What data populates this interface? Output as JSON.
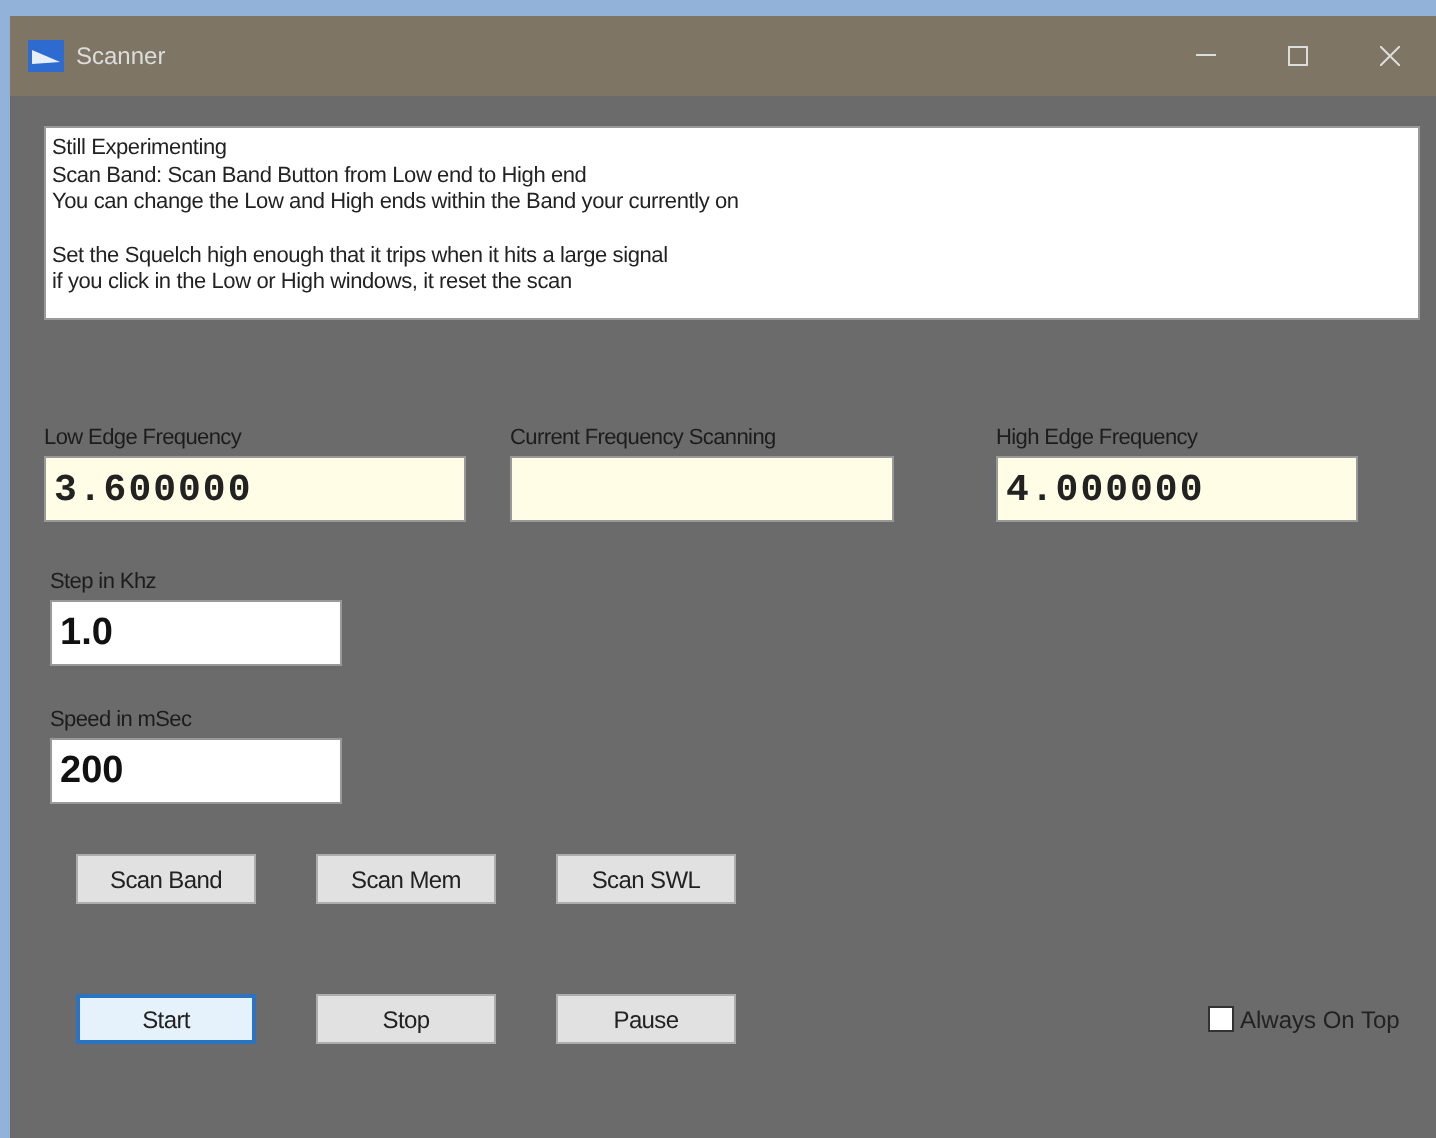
{
  "window": {
    "title": "Scanner"
  },
  "info": {
    "paragraphs": [
      {
        "lines": [
          "Still Experimenting",
          "Scan Band: Scan Band Button from Low end to High end",
          "You can change the Low and High ends within the Band your currently on"
        ]
      },
      {
        "lines": [
          "Set the Squelch high enough that it trips when it hits a large signal",
          "if you click in the Low or High windows, it reset the scan"
        ]
      }
    ]
  },
  "frequency_fields": [
    {
      "label": "Low Edge Frequency",
      "value": "3.600000"
    },
    {
      "label": "Current Frequency Scanning"
    },
    {
      "label": "High Edge Frequency",
      "value": "4.000000"
    }
  ],
  "settings_fields": [
    {
      "label": "Step in Khz",
      "value": "1.0"
    },
    {
      "label": "Speed in mSec",
      "value": "200"
    }
  ],
  "scan_buttons": [
    {
      "label": "Scan Band",
      "focused": false
    },
    {
      "label": "Scan Mem",
      "focused": false
    },
    {
      "label": "Scan SWL",
      "focused": false
    }
  ],
  "control_buttons": [
    {
      "label": "Start",
      "focused": true
    },
    {
      "label": "Stop",
      "focused": false
    },
    {
      "label": "Pause",
      "focused": false
    }
  ],
  "always_on_top": {
    "label": "Always On Top",
    "checked": false
  }
}
